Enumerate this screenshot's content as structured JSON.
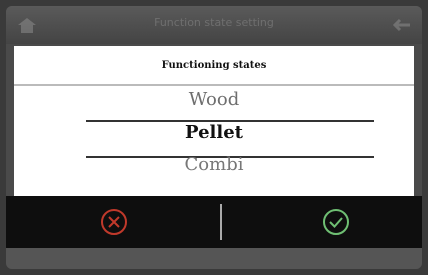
{
  "header": {
    "title": "Function state setting"
  },
  "dialog": {
    "title": "Functioning states",
    "options": [
      "Wood",
      "Pellet",
      "Combi"
    ],
    "selected": "Pellet"
  },
  "actions": {
    "cancel_icon": "cancel-circle-icon",
    "confirm_icon": "check-circle-icon"
  },
  "colors": {
    "cancel": "#c0392b",
    "confirm": "#6fbf73"
  }
}
